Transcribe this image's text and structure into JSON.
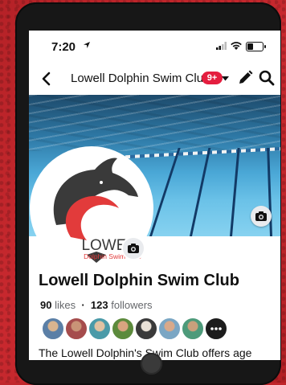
{
  "status_bar": {
    "time": "7:20"
  },
  "nav": {
    "title": "Lowell Dolphin Swim Club",
    "badge": "9+"
  },
  "profile": {
    "name": "Lowell Dolphin Swim Club",
    "logo_text": "LOWELL",
    "logo_subtext": "Dolphin Swim Club",
    "likes_count": "90",
    "likes_label": "likes",
    "separator": "·",
    "followers_count": "123",
    "followers_label": "followers",
    "description": "The Lowell Dolphin's Swim Club offers age"
  },
  "friend_avatars": [
    "avatar-1",
    "avatar-2",
    "avatar-3",
    "avatar-4",
    "avatar-5",
    "avatar-6",
    "avatar-7"
  ],
  "colors": {
    "background_red": "#c0262b",
    "notification_badge": "#e41e3f",
    "logo_red": "#e23b3b",
    "logo_dark": "#3a3a3a"
  }
}
